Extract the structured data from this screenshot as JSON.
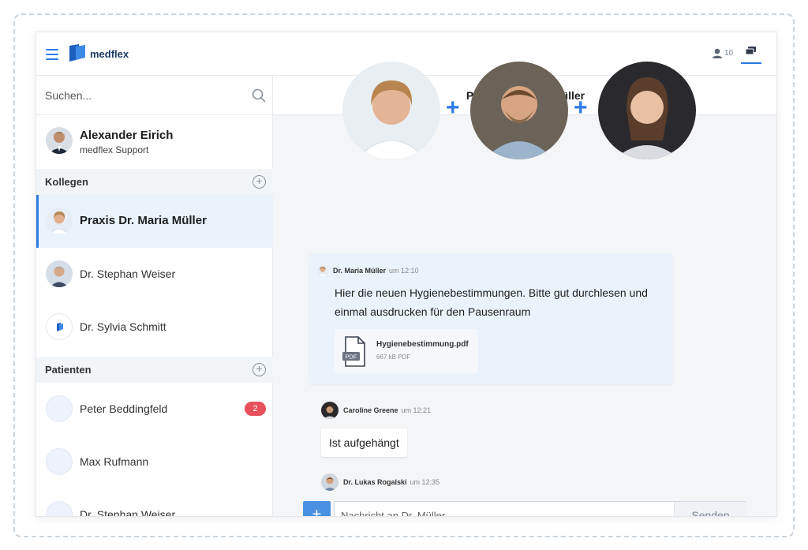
{
  "app": {
    "brand": "medflex",
    "colors": {
      "accent": "#2c7be5",
      "badge": "#e8505b"
    }
  },
  "topbar": {
    "people_count": "10",
    "icons": [
      "menu-icon",
      "user-icon",
      "chat-icon"
    ]
  },
  "sidebar": {
    "search_placeholder": "Suchen...",
    "current_user": {
      "name": "Alexander Eirich",
      "subtitle": "medflex Support"
    },
    "sections": {
      "colleagues": {
        "title": "Kollegen",
        "items": [
          {
            "label": "Praxis Dr. Maria Müller",
            "active": true
          },
          {
            "label": "Dr. Stephan Weiser"
          },
          {
            "label": "Dr. Sylvia Schmitt"
          }
        ]
      },
      "patients": {
        "title": "Patienten",
        "items": [
          {
            "label": "Peter Beddingfeld",
            "badge": "2"
          },
          {
            "label": "Max Rufmann"
          },
          {
            "label": "Dr. Stephan Weiser"
          }
        ]
      }
    }
  },
  "chat": {
    "title": "Praxis Dr. Maria Müller",
    "messages": [
      {
        "sender": "Dr. Maria Müller",
        "time": "um 12:10",
        "text": "Hier die neuen Hygienebestimmungen. Bitte gut durchlesen und einmal ausdrucken für den Pausenraum",
        "attachment": {
          "name": "Hygienebestimmung.pdf",
          "size": "667 kB PDF",
          "type": "PDF"
        }
      },
      {
        "sender": "Caroline Greene",
        "time": "um 12:21",
        "text": "Ist aufgehängt"
      },
      {
        "sender": "Dr. Lukas Rogalski",
        "time": "um 12:35"
      }
    ],
    "composer": {
      "placeholder": "Nachricht an Dr. Müller",
      "send_label": "Senden",
      "add_label": "+"
    }
  }
}
